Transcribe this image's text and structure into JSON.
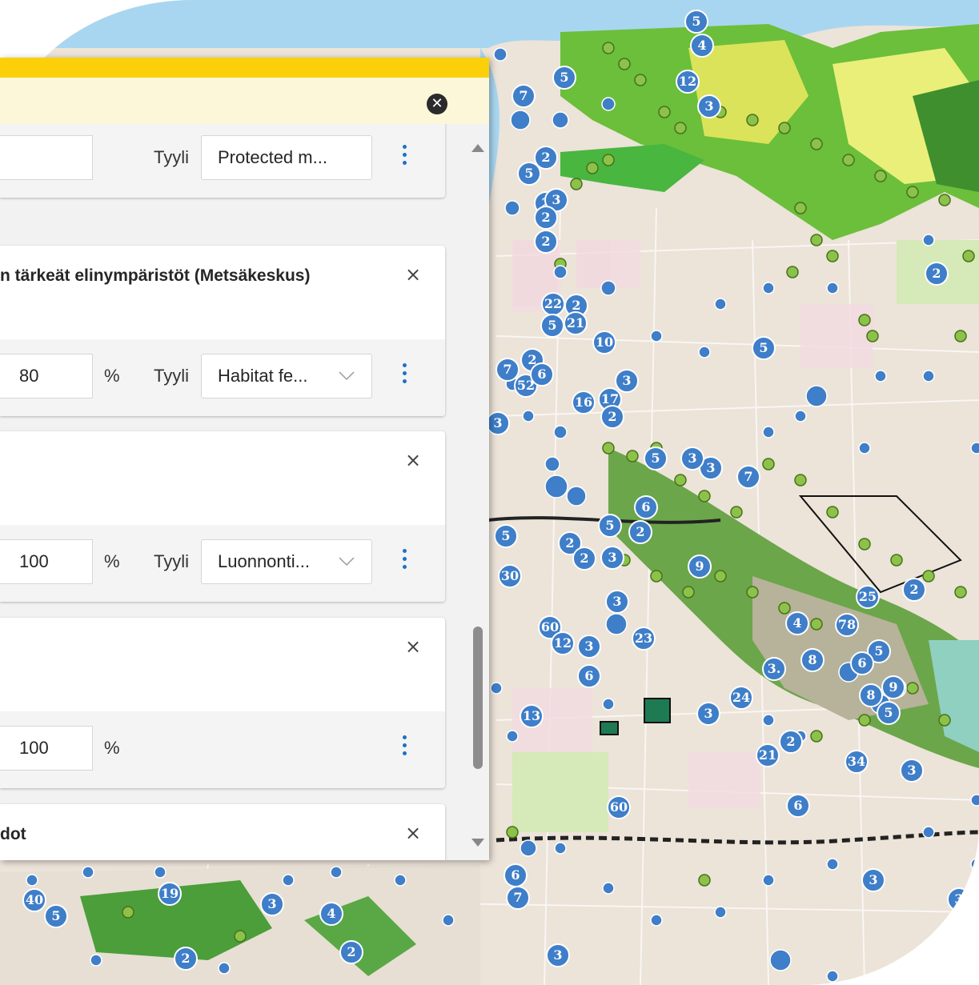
{
  "icons": {
    "panel_close": "close-circle-icon",
    "remove_layer": "close-icon",
    "style_dropdown": "chevron-down-icon",
    "layer_menu": "more-vertical-icon"
  },
  "colors": {
    "accent": "#fbd00b",
    "header_bg": "#fdf7d9",
    "menu_icon": "#1a73c8",
    "map_marker_blue": "#3f7ec8",
    "map_marker_green": "#8bc34a"
  },
  "panel": {
    "close_symbol": "✕",
    "layers": [
      {
        "title": "",
        "opacity": "",
        "percent": "",
        "style_label": "Tyyli",
        "style_value": "Protected m..."
      },
      {
        "title": "n tärkeät elinympäristöt (Metsäkeskus)",
        "remove_symbol": "×",
        "opacity": "80",
        "percent": "%",
        "style_label": "Tyyli",
        "style_value": "Habitat fe..."
      },
      {
        "title": "",
        "remove_symbol": "×",
        "opacity": "100",
        "percent": "%",
        "style_label": "Tyyli",
        "style_value": "Luonnonti..."
      },
      {
        "title": "",
        "remove_symbol": "×",
        "opacity": "100",
        "percent": "%"
      },
      {
        "title": "dot",
        "remove_symbol": "×"
      }
    ]
  },
  "map": {
    "cluster_labels": [
      "5",
      "4",
      "12",
      "3",
      "5",
      "7",
      "2",
      "5",
      "2",
      "3",
      "2",
      "2",
      "2",
      "22",
      "2",
      "5",
      "21",
      "10",
      "5",
      "3",
      "2",
      "7",
      "52",
      "6",
      "16",
      "17",
      "2",
      "3",
      "3",
      "5",
      "3",
      "7",
      "6",
      "5",
      "2",
      "2",
      "5",
      "2",
      "3",
      "30",
      "9",
      "3",
      "4",
      "25",
      "2",
      "60",
      "12",
      "3",
      "6",
      "23",
      "78",
      "5",
      "6",
      "8",
      "3.",
      "8",
      "9",
      "13",
      "24",
      "3",
      "5",
      "21",
      "2",
      "34",
      "3",
      "60",
      "6",
      "3",
      "7",
      "40",
      "5",
      "19",
      "3",
      "4",
      "2",
      "6",
      "3",
      "2",
      "3"
    ]
  }
}
